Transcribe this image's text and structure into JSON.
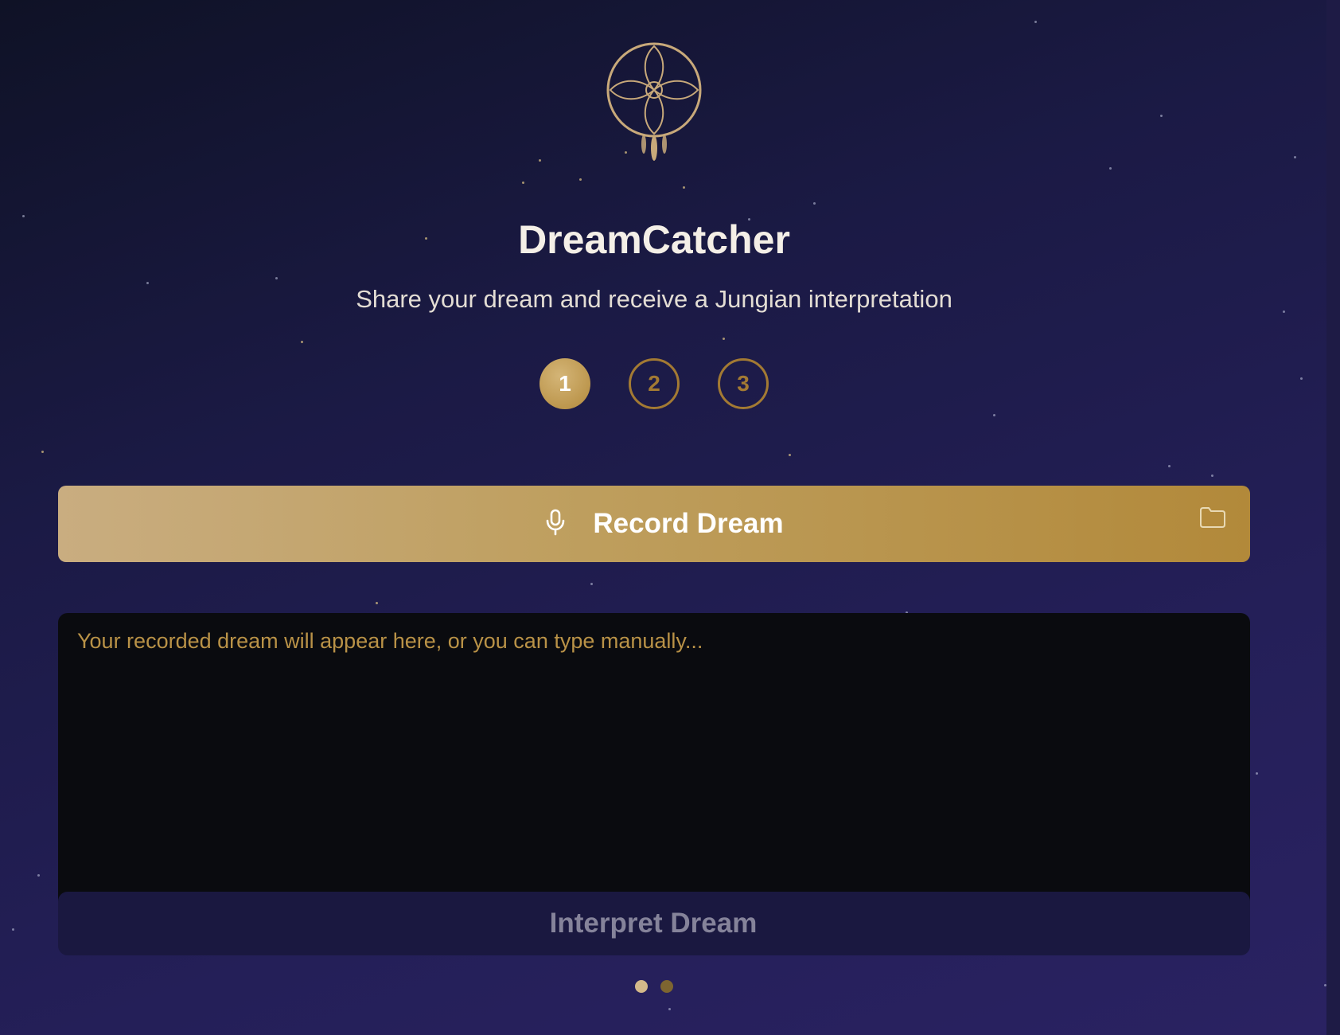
{
  "app": {
    "title": "DreamCatcher",
    "subtitle": "Share your dream and receive a Jungian interpretation",
    "logo_icon": "dreamcatcher-icon"
  },
  "steps": [
    {
      "label": "1",
      "state": "active"
    },
    {
      "label": "2",
      "state": "inactive"
    },
    {
      "label": "3",
      "state": "inactive"
    }
  ],
  "record": {
    "label": "Record Dream",
    "icon": "microphone-icon",
    "side_icon": "folder-icon"
  },
  "dream_input": {
    "value": "",
    "placeholder": "Your recorded dream will appear here, or you can type manually..."
  },
  "interpret": {
    "label": "Interpret Dream",
    "enabled": false
  },
  "pagination": {
    "total": 2,
    "current": 1
  },
  "colors": {
    "gold": "#b99247",
    "gold_light": "#d4b98a",
    "title": "#f4efe7",
    "input_bg": "#0a0b0f",
    "dot_active": "#d4b98a",
    "dot_inactive": "#7d6530"
  }
}
